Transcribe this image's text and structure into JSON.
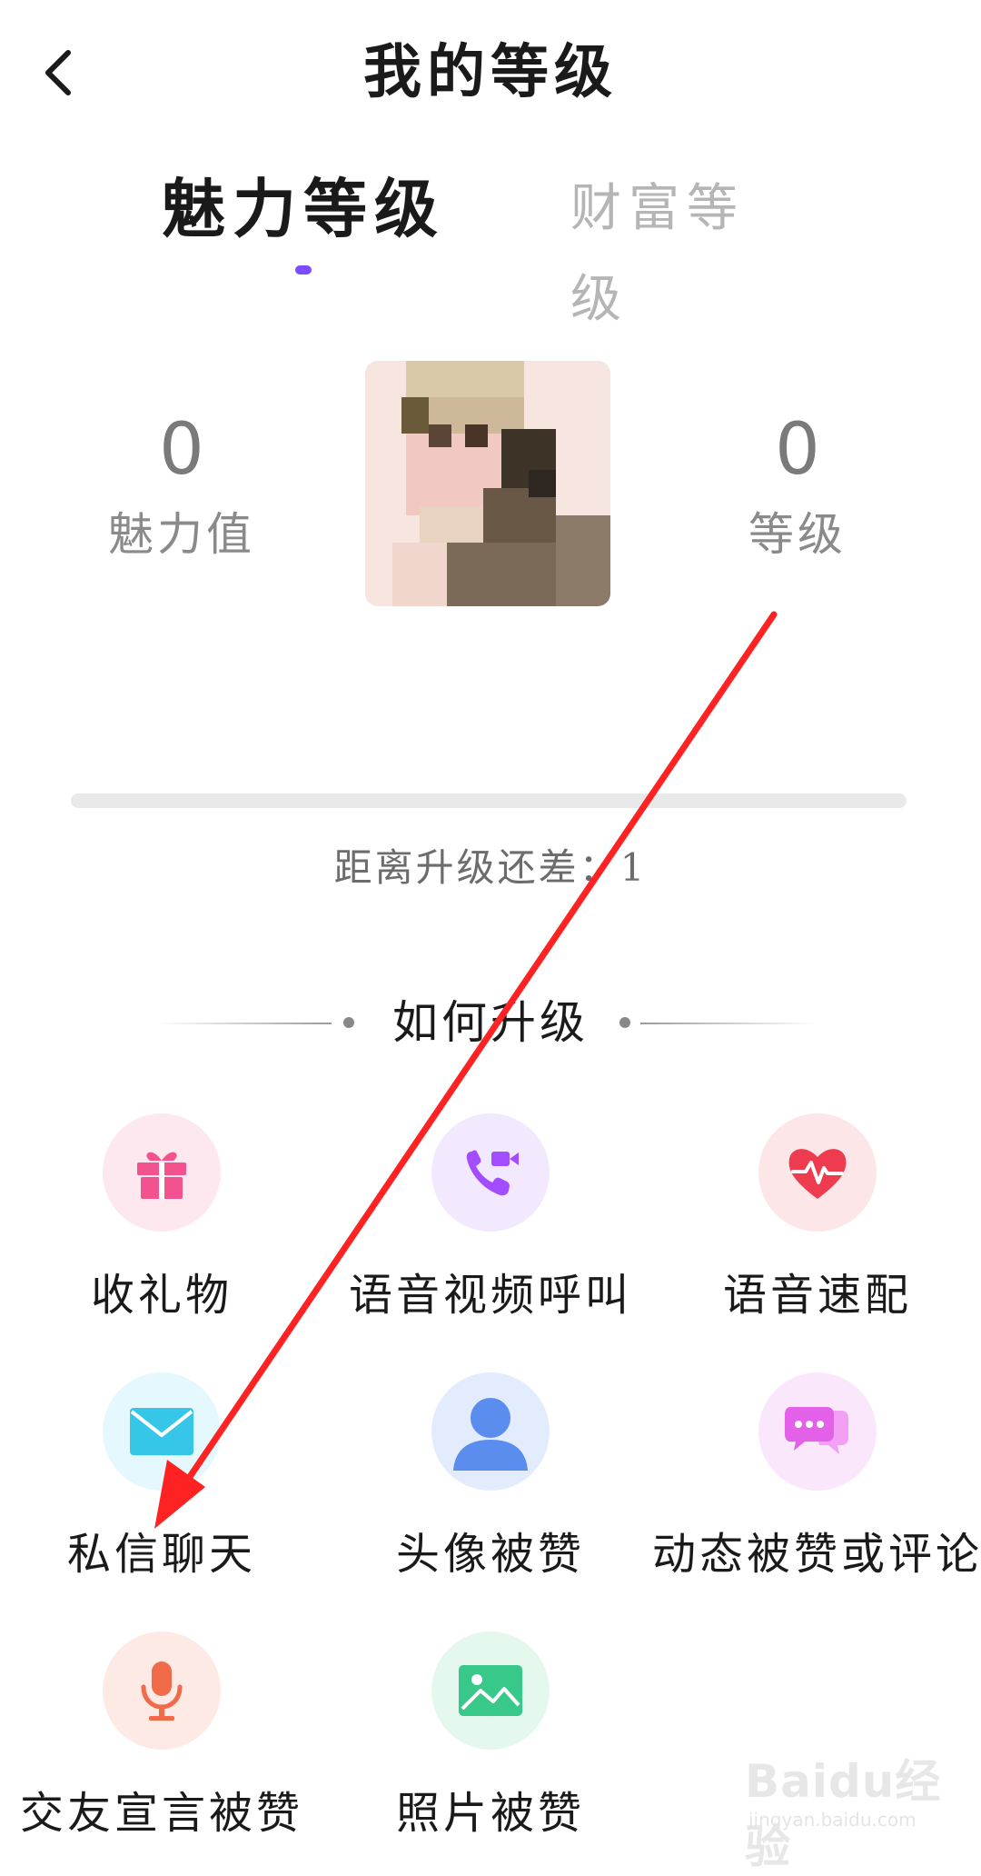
{
  "header": {
    "title": "我的等级"
  },
  "tabs": [
    {
      "label": "魅力等级",
      "active": true
    },
    {
      "label": "财富等级",
      "active": false
    }
  ],
  "stats": {
    "charm_value": "0",
    "charm_label": "魅力值",
    "level_value": "0",
    "level_label": "等级"
  },
  "progress": {
    "fraction": 0,
    "text": "距离升级还差：1"
  },
  "how_to_upgrade": {
    "title": "如何升级",
    "items": [
      {
        "label": "收礼物",
        "icon": "gift-icon",
        "color": "#f2538f",
        "bg": "#fde8f0"
      },
      {
        "label": "语音视频呼叫",
        "icon": "video-call-icon",
        "color": "#a24dff",
        "bg": "#f3e9ff"
      },
      {
        "label": "语音速配",
        "icon": "heart-pulse-icon",
        "color": "#ee3b4f",
        "bg": "#fde6e8"
      },
      {
        "label": "私信聊天",
        "icon": "envelope-icon",
        "color": "#35c6e8",
        "bg": "#e4f8fd"
      },
      {
        "label": "头像被赞",
        "icon": "user-icon",
        "color": "#5b8def",
        "bg": "#e3ecfd"
      },
      {
        "label": "动态被赞或评论",
        "icon": "chat-bubbles-icon",
        "color": "#e361e8",
        "bg": "#fbe7fc"
      },
      {
        "label": "交友宣言被赞",
        "icon": "microphone-icon",
        "color": "#f16b4a",
        "bg": "#fdeae4"
      },
      {
        "label": "照片被赞",
        "icon": "image-icon",
        "color": "#37c88a",
        "bg": "#e4f8ee"
      }
    ]
  },
  "watermark": {
    "brand": "Baidu经验",
    "url": "jingyan.baidu.com"
  },
  "colors": {
    "accent": "#7b4dff",
    "annotation": "#ff2222"
  }
}
